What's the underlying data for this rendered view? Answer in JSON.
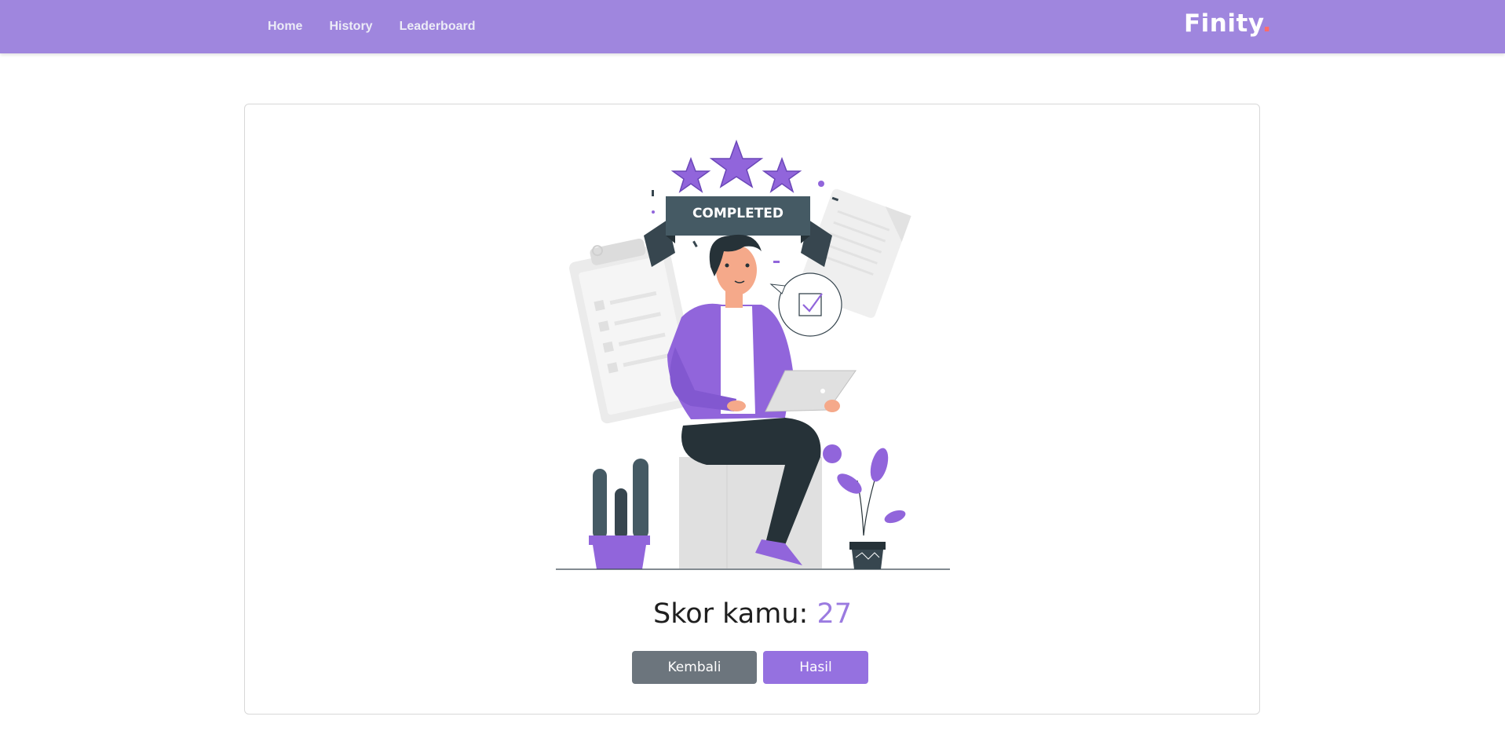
{
  "nav": {
    "links": [
      "Home",
      "History",
      "Leaderboard"
    ],
    "brand": "Finity",
    "brand_dot": "."
  },
  "illustration": {
    "banner_text": "COMPLETED"
  },
  "result": {
    "score_label": "Skor kamu: ",
    "score_value": "27"
  },
  "actions": {
    "back_label": "Kembali",
    "result_label": "Hasil"
  },
  "colors": {
    "navbar": "#9f86de",
    "accent": "#9571e0",
    "secondary": "#6c757d"
  }
}
